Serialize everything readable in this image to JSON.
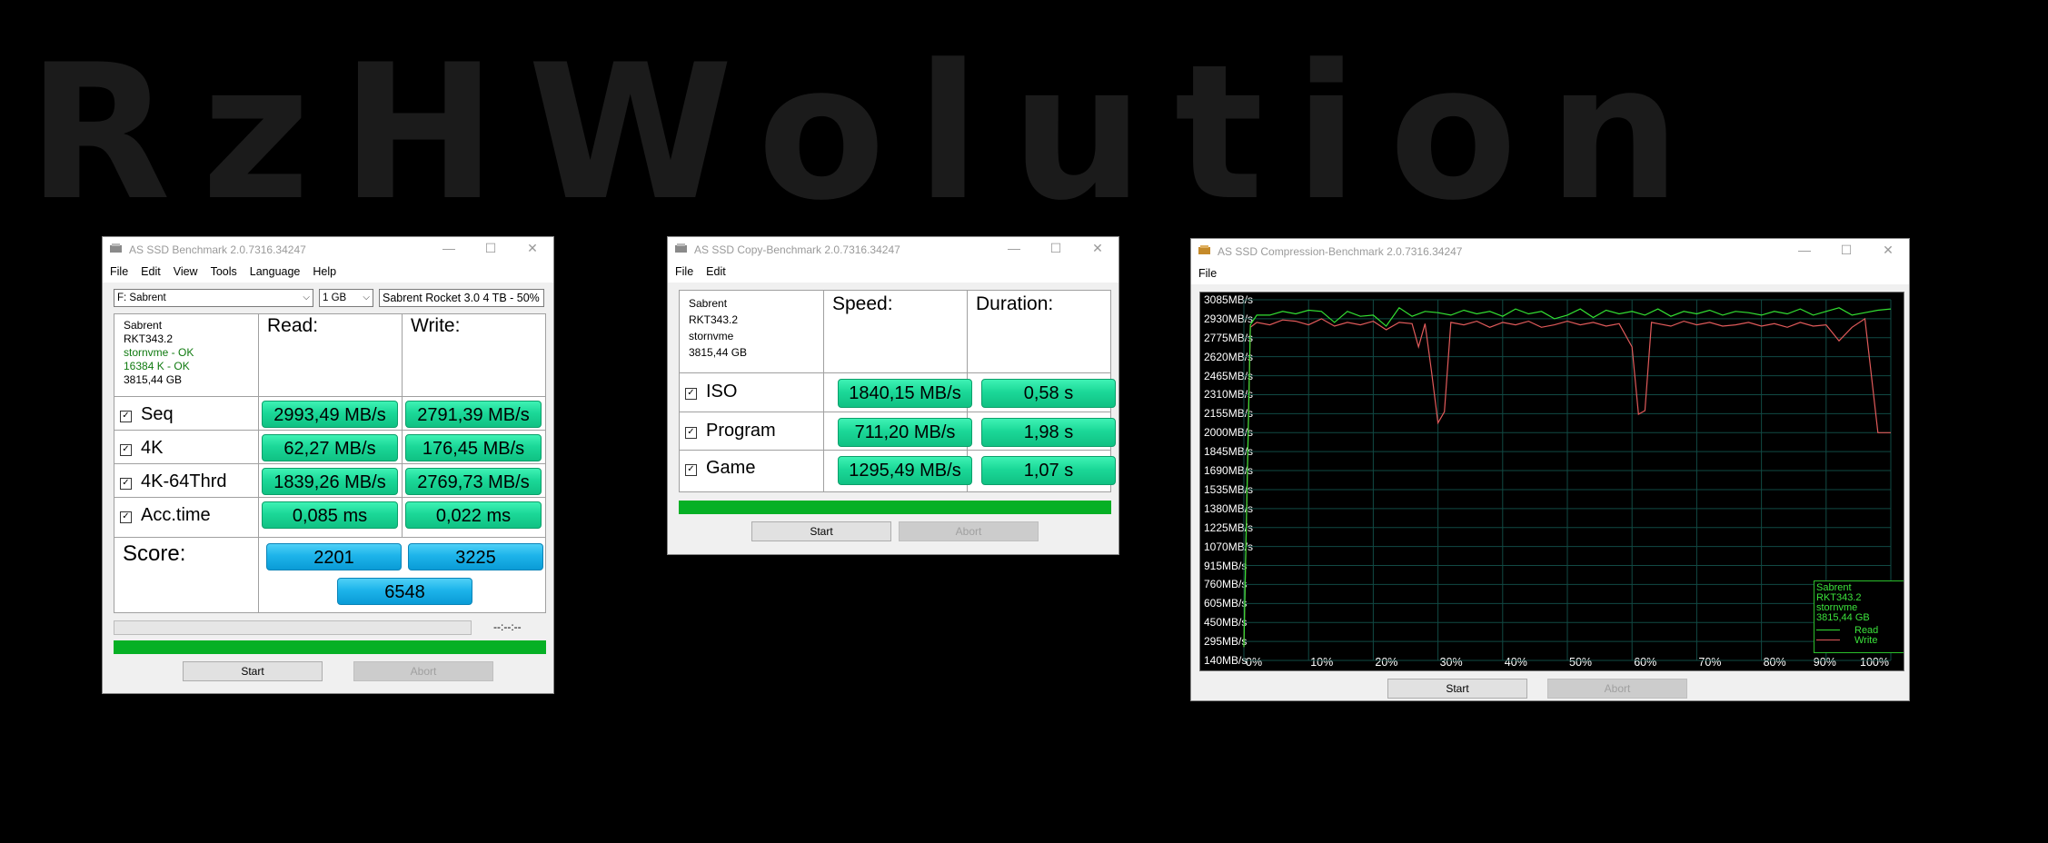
{
  "logo_text": "RzHWolution",
  "window1": {
    "title": "AS SSD Benchmark 2.0.7316.34247",
    "controls": [
      "—",
      "☐",
      "✕"
    ],
    "menu": [
      "File",
      "Edit",
      "View",
      "Tools",
      "Language",
      "Help"
    ],
    "drive_select": "F: Sabrent",
    "size_select": "1 GB",
    "drive_name": "Sabrent Rocket 3.0 4 TB - 50%",
    "device": {
      "name": "Sabrent",
      "firmware": "RKT343.2",
      "driver": "stornvme - OK",
      "align": "16384 K - OK",
      "capacity": "3815,44 GB"
    },
    "headers": {
      "read": "Read:",
      "write": "Write:"
    },
    "rows": [
      {
        "label": "Seq",
        "read": "2993,49 MB/s",
        "write": "2791,39 MB/s"
      },
      {
        "label": "4K",
        "read": "62,27 MB/s",
        "write": "176,45 MB/s"
      },
      {
        "label": "4K-64Thrd",
        "read": "1839,26 MB/s",
        "write": "2769,73 MB/s"
      },
      {
        "label": "Acc.time",
        "read": "0,085 ms",
        "write": "0,022 ms"
      }
    ],
    "score_label": "Score:",
    "score_read": "2201",
    "score_write": "3225",
    "score_total": "6548",
    "time_text": "--:--:--",
    "progress": 1.0,
    "start": "Start",
    "abort": "Abort"
  },
  "window2": {
    "title": "AS SSD Copy-Benchmark 2.0.7316.34247",
    "controls": [
      "—",
      "☐",
      "✕"
    ],
    "menu": [
      "File",
      "Edit"
    ],
    "device": {
      "name": "Sabrent",
      "firmware": "RKT343.2",
      "driver": "stornvme",
      "capacity": "3815,44 GB"
    },
    "headers": {
      "speed": "Speed:",
      "duration": "Duration:"
    },
    "rows": [
      {
        "label": "ISO",
        "speed": "1840,15 MB/s",
        "duration": "0,58 s"
      },
      {
        "label": "Program",
        "speed": "711,20 MB/s",
        "duration": "1,98 s"
      },
      {
        "label": "Game",
        "speed": "1295,49 MB/s",
        "duration": "1,07 s"
      }
    ],
    "progress": 1.0,
    "start": "Start",
    "abort": "Abort"
  },
  "window3": {
    "title": "AS SSD Compression-Benchmark 2.0.7316.34247",
    "controls": [
      "—",
      "☐",
      "✕"
    ],
    "menu": [
      "File"
    ],
    "legend": {
      "name": "Sabrent",
      "firmware": "RKT343.2",
      "driver": "stornvme",
      "capacity": "3815,44 GB",
      "read": "Read",
      "write": "Write"
    },
    "start": "Start",
    "abort": "Abort"
  },
  "colors": {
    "read_line": "#33e033",
    "write_line": "#e05a5a",
    "grid": "#114a44",
    "green_result": "#1bd898",
    "blue_score": "#1db4ea"
  },
  "chart_data": {
    "type": "line",
    "title": "",
    "xlabel": "",
    "ylabel": "",
    "yticks": [
      "3085MB/s",
      "2930MB/s",
      "2775MB/s",
      "2620MB/s",
      "2465MB/s",
      "2310MB/s",
      "2155MB/s",
      "2000MB/s",
      "1845MB/s",
      "1690MB/s",
      "1535MB/s",
      "1380MB/s",
      "1225MB/s",
      "1070MB/s",
      "915MB/s",
      "760MB/s",
      "605MB/s",
      "450MB/s",
      "295MB/s",
      "140MB/s"
    ],
    "xticks": [
      "0%",
      "10%",
      "20%",
      "30%",
      "40%",
      "50%",
      "60%",
      "70%",
      "80%",
      "90%",
      "100%"
    ],
    "ylim": [
      140,
      3085
    ],
    "xlim": [
      0,
      100
    ],
    "series": [
      {
        "name": "Read",
        "x": [
          0,
          1,
          2,
          4,
          6,
          8,
          10,
          12,
          14,
          16,
          18,
          20,
          22,
          24,
          26,
          28,
          30,
          32,
          34,
          36,
          38,
          40,
          42,
          44,
          46,
          48,
          50,
          52,
          54,
          56,
          58,
          60,
          62,
          64,
          66,
          68,
          70,
          72,
          74,
          76,
          78,
          80,
          82,
          84,
          86,
          88,
          90,
          92,
          94,
          96,
          98,
          100
        ],
        "values": [
          250,
          2880,
          2960,
          2960,
          2990,
          2970,
          3000,
          2990,
          2900,
          2990,
          2950,
          2960,
          2870,
          3020,
          2950,
          2990,
          2980,
          2960,
          3000,
          2970,
          2990,
          2950,
          3010,
          2970,
          2990,
          2930,
          2960,
          3010,
          2940,
          3000,
          2970,
          2990,
          2960,
          3010,
          2950,
          2990,
          2970,
          3000,
          2960,
          2990,
          2980,
          2960,
          2990,
          2970,
          3010,
          2960,
          2990,
          3020,
          2960,
          2980,
          3000,
          3010
        ]
      },
      {
        "name": "Write",
        "x": [
          0,
          1,
          2,
          4,
          6,
          8,
          10,
          12,
          14,
          16,
          18,
          20,
          22,
          24,
          26,
          27,
          28,
          29,
          30,
          31,
          32,
          34,
          36,
          38,
          40,
          42,
          44,
          46,
          48,
          50,
          52,
          54,
          56,
          58,
          60,
          61,
          62,
          63,
          64,
          66,
          68,
          70,
          72,
          74,
          76,
          78,
          80,
          82,
          84,
          86,
          88,
          90,
          92,
          94,
          96,
          98,
          100
        ],
        "values": [
          250,
          2860,
          2900,
          2880,
          2920,
          2910,
          2880,
          2930,
          2870,
          2900,
          2880,
          2910,
          2840,
          2900,
          2890,
          2700,
          2890,
          2500,
          2080,
          2170,
          2900,
          2880,
          2910,
          2860,
          2900,
          2880,
          2910,
          2860,
          2880,
          2910,
          2880,
          2900,
          2870,
          2890,
          2700,
          2150,
          2180,
          2900,
          2890,
          2870,
          2910,
          2880,
          2900,
          2870,
          2880,
          2900,
          2870,
          2890,
          2860,
          2900,
          2870,
          2880,
          2750,
          2860,
          2930,
          2000,
          2000
        ]
      }
    ]
  }
}
